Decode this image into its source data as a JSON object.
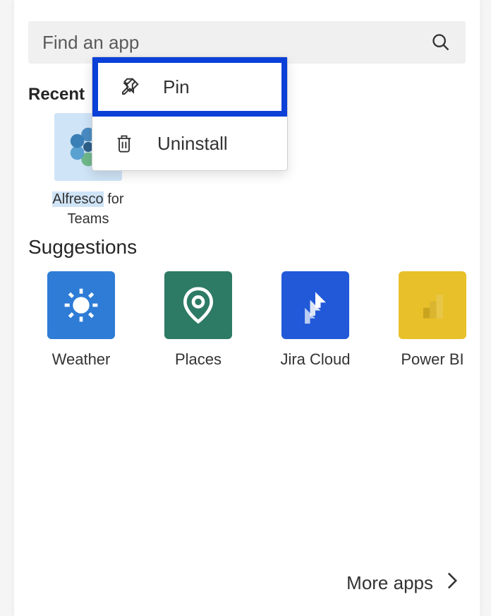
{
  "search": {
    "placeholder": "Find an app"
  },
  "sections": {
    "recent_title": "Recent",
    "suggestions_title": "Suggestions"
  },
  "recent": [
    {
      "label_part1": "Alfresco",
      "label_part2": " for Teams"
    }
  ],
  "suggestions": [
    {
      "label": "Weather"
    },
    {
      "label": "Places"
    },
    {
      "label": "Jira Cloud"
    },
    {
      "label": "Power BI"
    }
  ],
  "context_menu": {
    "pin_label": "Pin",
    "uninstall_label": "Uninstall"
  },
  "footer": {
    "more_apps": "More apps"
  }
}
